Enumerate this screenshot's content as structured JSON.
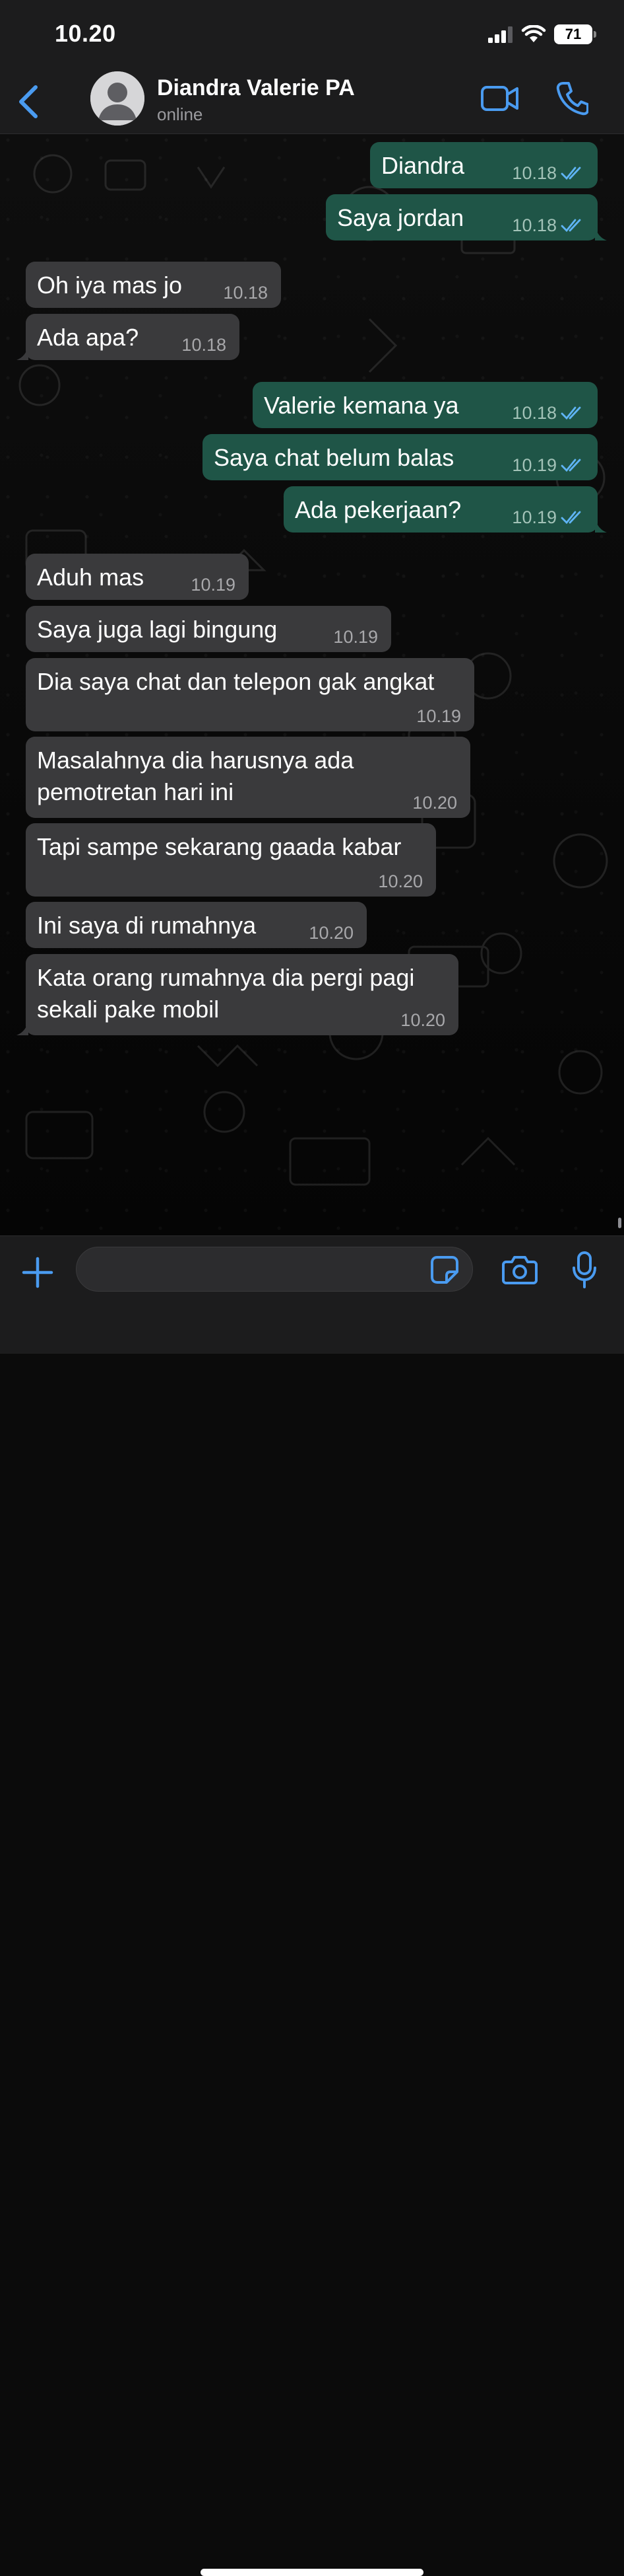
{
  "status_bar": {
    "time": "10.20",
    "battery": "71"
  },
  "header": {
    "contact_name": "Diandra Valerie PA",
    "contact_status": "online"
  },
  "messages": [
    {
      "dir": "out",
      "text": "Diandra",
      "time": "10.18",
      "read": true
    },
    {
      "dir": "out",
      "text": "Saya jordan",
      "time": "10.18",
      "read": true
    },
    {
      "dir": "in",
      "text": "Oh iya mas jo",
      "time": "10.18"
    },
    {
      "dir": "in",
      "text": "Ada apa?",
      "time": "10.18"
    },
    {
      "dir": "out",
      "text": "Valerie kemana ya",
      "time": "10.18",
      "read": true
    },
    {
      "dir": "out",
      "text": "Saya chat belum balas",
      "time": "10.19",
      "read": true
    },
    {
      "dir": "out",
      "text": "Ada pekerjaan?",
      "time": "10.19",
      "read": true
    },
    {
      "dir": "in",
      "text": "Aduh mas",
      "time": "10.19"
    },
    {
      "dir": "in",
      "text": "Saya juga lagi bingung",
      "time": "10.19"
    },
    {
      "dir": "in",
      "text": "Dia saya chat dan telepon gak angkat",
      "time": "10.19"
    },
    {
      "dir": "in",
      "text": "Masalahnya dia harusnya ada pemotretan hari ini",
      "time": "10.20"
    },
    {
      "dir": "in",
      "text": "Tapi sampe sekarang gaada kabar",
      "time": "10.20"
    },
    {
      "dir": "in",
      "text": "Ini saya di rumahnya",
      "time": "10.20"
    },
    {
      "dir": "in",
      "text": "Kata orang rumahnya dia pergi pagi sekali pake mobil",
      "time": "10.20"
    }
  ],
  "input": {
    "placeholder": ""
  },
  "icons": {
    "back": "chevron-left-icon",
    "video": "video-camera-icon",
    "call": "phone-icon",
    "plus": "plus-icon",
    "sticker": "sticker-icon",
    "camera": "camera-icon",
    "mic": "microphone-icon"
  },
  "colors": {
    "accent": "#4a9bf0",
    "outgoing_bubble": "#1f5547",
    "incoming_bubble": "#3a3a3c",
    "bar_background": "#1c1c1d",
    "read_ticks": "#5fb4f5"
  }
}
